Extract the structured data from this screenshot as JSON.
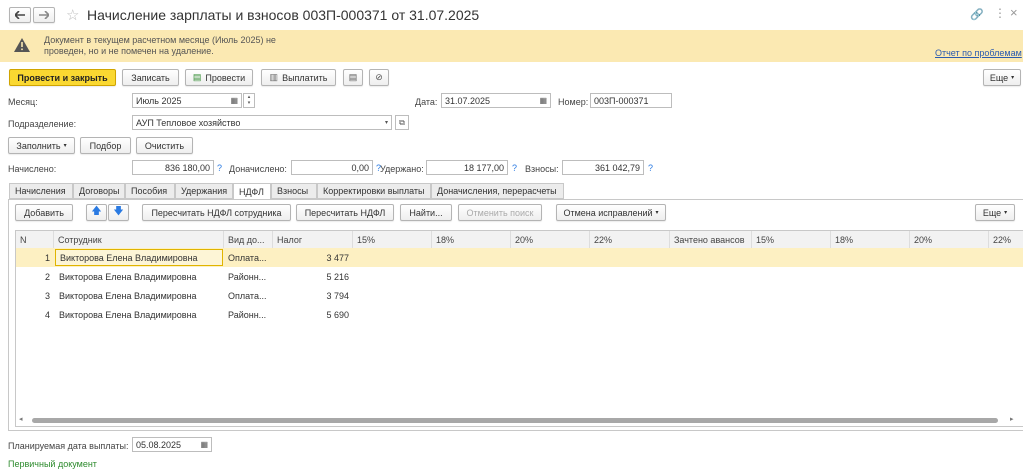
{
  "window": {
    "title": "Начисление зарплаты и взносов 003П-000371 от 31.07.2025"
  },
  "warning": {
    "text_line1": "Документ в текущем расчетном месяце (Июль 2025) не",
    "text_line2": "проведен, но и не помечен на удаление.",
    "link": "Отчет по проблемам"
  },
  "toolbar": {
    "post_close": "Провести и закрыть",
    "save": "Записать",
    "post": "Провести",
    "pay": "Выплатить",
    "more": "Еще"
  },
  "form": {
    "month_label": "Месяц:",
    "month_value": "Июль 2025",
    "date_label": "Дата:",
    "date_value": "31.07.2025",
    "number_label": "Номер:",
    "number_value": "003П-000371",
    "dept_label": "Подразделение:",
    "dept_value": "АУП Тепловое хозяйство"
  },
  "actions": {
    "fill": "Заполнить",
    "select": "Подбор",
    "clear": "Очистить"
  },
  "totals": {
    "accrued_label": "Начислено:",
    "accrued": "836 180,00",
    "additional_label": "Доначислено:",
    "additional": "0,00",
    "withheld_label": "Удержано:",
    "withheld": "18 177,00",
    "contrib_label": "Взносы:",
    "contrib": "361 042,79",
    "q": "?"
  },
  "tabs": [
    "Начисления",
    "Договоры",
    "Пособия",
    "Удержания",
    "НДФЛ",
    "Взносы",
    "Корректировки выплаты",
    "Доначисления, перерасчеты"
  ],
  "grid_toolbar": {
    "add": "Добавить",
    "recalc_emp": "Пересчитать НДФЛ сотрудника",
    "recalc": "Пересчитать НДФЛ",
    "find": "Найти...",
    "cancel_search": "Отменить поиск",
    "cancel_corr": "Отмена исправлений",
    "more": "Еще"
  },
  "table": {
    "headers": [
      "N",
      "Сотрудник",
      "Вид до...",
      "Налог",
      "15%",
      "18%",
      "20%",
      "22%",
      "Зачтено авансов",
      "15%",
      "18%",
      "20%",
      "22%"
    ],
    "rows": [
      {
        "n": "1",
        "employee": "Викторова Елена Владимировна",
        "kind": "Оплата...",
        "tax": "3 477"
      },
      {
        "n": "2",
        "employee": "Викторова Елена Владимировна",
        "kind": "Районн...",
        "tax": "5 216"
      },
      {
        "n": "3",
        "employee": "Викторова Елена Владимировна",
        "kind": "Оплата...",
        "tax": "3 794"
      },
      {
        "n": "4",
        "employee": "Викторова Елена Владимировна",
        "kind": "Районн...",
        "tax": "5 690"
      }
    ]
  },
  "footer": {
    "pay_date_label": "Планируемая дата выплаты:",
    "pay_date": "05.08.2025",
    "primary_doc": "Первичный документ"
  },
  "colors": {
    "accent": "#fad831",
    "warning_bg": "#fbe9b2",
    "selected_row": "#fdf0c2",
    "link": "#2a5bb0",
    "green": "#2e8b2e"
  }
}
